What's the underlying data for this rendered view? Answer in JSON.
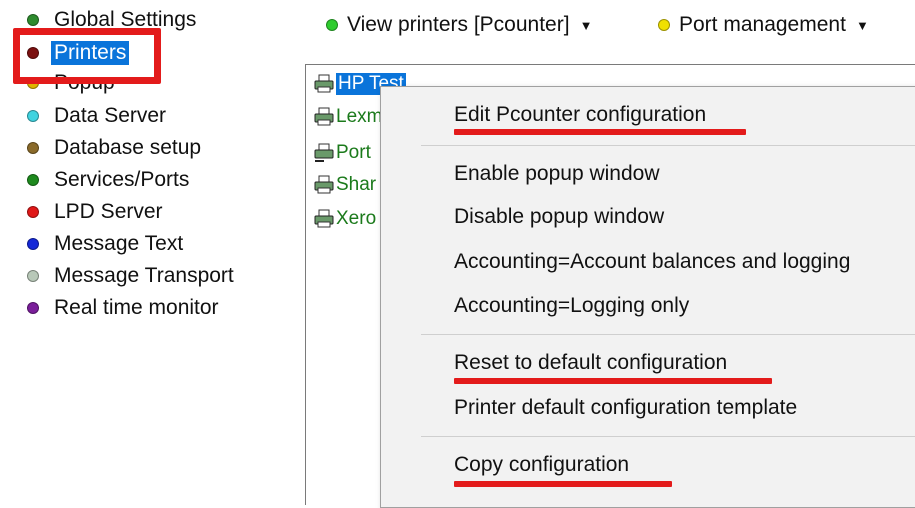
{
  "sidebar": {
    "items": [
      {
        "label": "Global Settings",
        "color": "#2e8b2e"
      },
      {
        "label": "Printers",
        "color": "#7b1010",
        "selected": true
      },
      {
        "label": "Popup",
        "color": "#e0b400"
      },
      {
        "label": "Data Server",
        "color": "#3fd3e0"
      },
      {
        "label": "Database setup",
        "color": "#8a6a2a"
      },
      {
        "label": "Services/Ports",
        "color": "#1e8a1e"
      },
      {
        "label": "LPD Server",
        "color": "#e01818"
      },
      {
        "label": "Message Text",
        "color": "#1428d8"
      },
      {
        "label": "Message Transport",
        "color": "#b8c8b8"
      },
      {
        "label": "Real time monitor",
        "color": "#7a1e9a"
      }
    ]
  },
  "toolbar": {
    "view_printers": {
      "label": "View printers [Pcounter]",
      "color": "#2ecc2e"
    },
    "port_management": {
      "label": "Port management",
      "color": "#f0e000"
    }
  },
  "printers": [
    {
      "name": "HP Test",
      "selected": true
    },
    {
      "name": "Lexm"
    },
    {
      "name": "Port"
    },
    {
      "name": "Shar"
    },
    {
      "name": "Xero"
    }
  ],
  "context_menu": {
    "items": [
      "Edit Pcounter configuration",
      "Enable popup window",
      "Disable popup window",
      "Accounting=Account balances and logging",
      "Accounting=Logging only",
      "Reset to default configuration",
      "Printer default configuration template",
      "Copy configuration"
    ]
  },
  "colors": {
    "selection": "#0a74da",
    "annotation_red": "#e31b1b",
    "printer_text": "#1b7a1b"
  }
}
